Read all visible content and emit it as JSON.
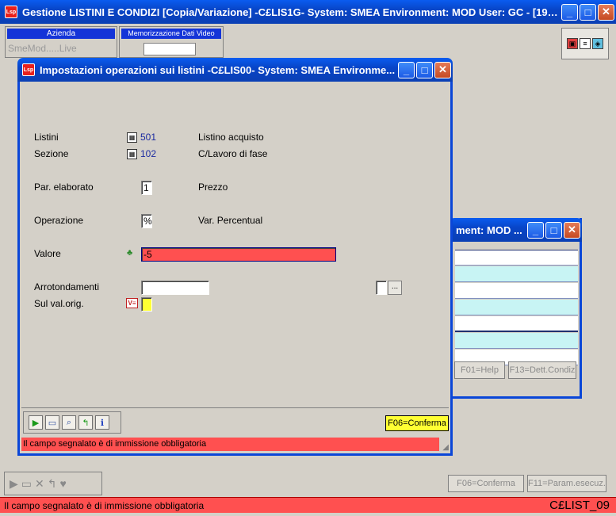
{
  "main_window": {
    "title": "Gestione LISTINI E CONDIZI [Copia/Variazione] -C£LIS1G- System: SMEA Environment: MOD User: GC - [195...",
    "minimize_glyph": "_",
    "maximize_glyph": "□",
    "close_glyph": "✕"
  },
  "header": {
    "azienda_label": "Azienda",
    "azienda_value": "SmeMod.....Live",
    "memorizzazione_label": "Memorizzazione Dati Video"
  },
  "background_window": {
    "title": "ment: MOD ...",
    "buttons": {
      "help": "F01=Help",
      "dett": "F13=Dett.Condiz"
    }
  },
  "dialog": {
    "title": "Impostazioni operazioni sui listini -C£LIS00- System: SMEA Environme...",
    "fields": {
      "listini": {
        "label": "Listini",
        "code": "501",
        "description": "Listino acquisto"
      },
      "sezione": {
        "label": "Sezione",
        "code": "102",
        "description": "C/Lavoro di fase"
      },
      "par_elaborato": {
        "label": "Par. elaborato",
        "value": "1",
        "description": "Prezzo"
      },
      "operazione": {
        "label": "Operazione",
        "value": "%",
        "description": "Var. Percentual"
      },
      "valore": {
        "label": "Valore",
        "value": "-5"
      },
      "arrotondamenti": {
        "label": "Arrotondamenti",
        "value": "",
        "lookup": "..."
      },
      "sul_val_orig": {
        "label": "Sul val.orig.",
        "value": ""
      }
    },
    "conferma_button": "F06=Conferma",
    "status": "Il campo segnalato è di immissione obbligatoria"
  },
  "bottom": {
    "conferma_button": "F06=Conferma",
    "param_button": "F11=Param.esecuz.",
    "status": "Il campo segnalato è di immissione obbligatoria",
    "code": "C£LIST_09"
  },
  "colors": {
    "titlebar_blue": "#0a46d8",
    "error_red": "#ff5050",
    "confirm_yellow": "#ffff33",
    "link_blue": "#1a2aa0"
  }
}
